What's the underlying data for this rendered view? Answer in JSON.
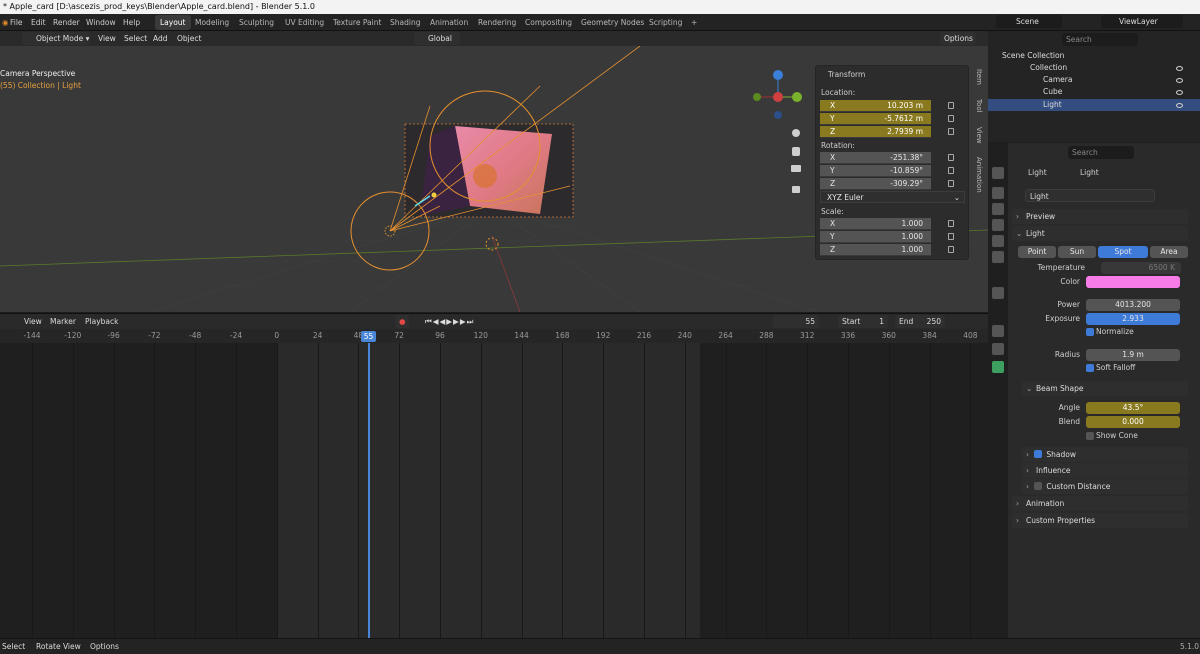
{
  "window_title": "* Apple_card [D:\\ascezis_prod_keys\\Blender\\Apple_card.blend] - Blender 5.1.0",
  "menu": [
    "File",
    "Edit",
    "Render",
    "Window",
    "Help"
  ],
  "workspaces": [
    "Layout",
    "Modeling",
    "Sculpting",
    "UV Editing",
    "Texture Paint",
    "Shading",
    "Animation",
    "Rendering",
    "Compositing",
    "Geometry Nodes",
    "Scripting"
  ],
  "workspace_add": "+",
  "scene": "Scene",
  "viewlayer": "ViewLayer",
  "vp_header": {
    "mode": "Object Mode",
    "view": "View",
    "select": "Select",
    "add": "Add",
    "object": "Object",
    "orientation": "Global",
    "options": "Options"
  },
  "viewport": {
    "perspective": "Camera Perspective",
    "collection": "(55) Collection | Light"
  },
  "transform": {
    "title": "Transform",
    "location": "Location:",
    "loc": [
      {
        "ax": "X",
        "v": "10.203 m"
      },
      {
        "ax": "Y",
        "v": "-5.7612 m"
      },
      {
        "ax": "Z",
        "v": "2.7939 m"
      }
    ],
    "rotation": "Rotation:",
    "rot": [
      {
        "ax": "X",
        "v": "-251.38°"
      },
      {
        "ax": "Y",
        "v": "-10.859°"
      },
      {
        "ax": "Z",
        "v": "-309.29°"
      }
    ],
    "rot_mode": "XYZ Euler",
    "scale": "Scale:",
    "sc": [
      {
        "ax": "X",
        "v": "1.000"
      },
      {
        "ax": "Y",
        "v": "1.000"
      },
      {
        "ax": "Z",
        "v": "1.000"
      }
    ]
  },
  "npanel_tabs": [
    "Item",
    "Tool",
    "View",
    "Animation"
  ],
  "timeline": {
    "view": "View",
    "marker": "Marker",
    "playback": "Playback",
    "current": "55",
    "start_label": "Start",
    "start": "1",
    "end_label": "End",
    "end": "250",
    "playhead": "55",
    "ticks": [
      "-144",
      "-120",
      "-96",
      "-72",
      "-48",
      "-24",
      "0",
      "24",
      "48",
      "72",
      "96",
      "120",
      "144",
      "168",
      "192",
      "216",
      "240",
      "264",
      "288",
      "312",
      "336",
      "360",
      "384",
      "408"
    ]
  },
  "status": {
    "select": "Select",
    "rotate": "Rotate View",
    "options": "Options",
    "version": "5.1.0"
  },
  "outliner": {
    "search": "Search",
    "scene_collection": "Scene Collection",
    "collection": "Collection",
    "items": [
      "Camera",
      "Cube",
      "Light"
    ]
  },
  "props": {
    "search": "Search",
    "object": "Light",
    "data": "Light",
    "datablock": "Light",
    "preview": "Preview",
    "light": "Light",
    "types": [
      "Point",
      "Sun",
      "Spot",
      "Area"
    ],
    "temperature_label": "Temperature",
    "temperature": "6500 K",
    "color_label": "Color",
    "color": "#f77ce8",
    "power_label": "Power",
    "power": "4013.200",
    "exposure_label": "Exposure",
    "exposure": "2.933",
    "normalize": "Normalize",
    "radius_label": "Radius",
    "radius": "1.9 m",
    "soft_falloff": "Soft Falloff",
    "beam_shape": "Beam Shape",
    "angle_label": "Angle",
    "angle": "43.5°",
    "blend_label": "Blend",
    "blend": "0.000",
    "show_cone": "Show Cone",
    "shadow": "Shadow",
    "influence": "Influence",
    "custom_distance": "Custom Distance",
    "animation": "Animation",
    "custom_properties": "Custom Properties"
  }
}
